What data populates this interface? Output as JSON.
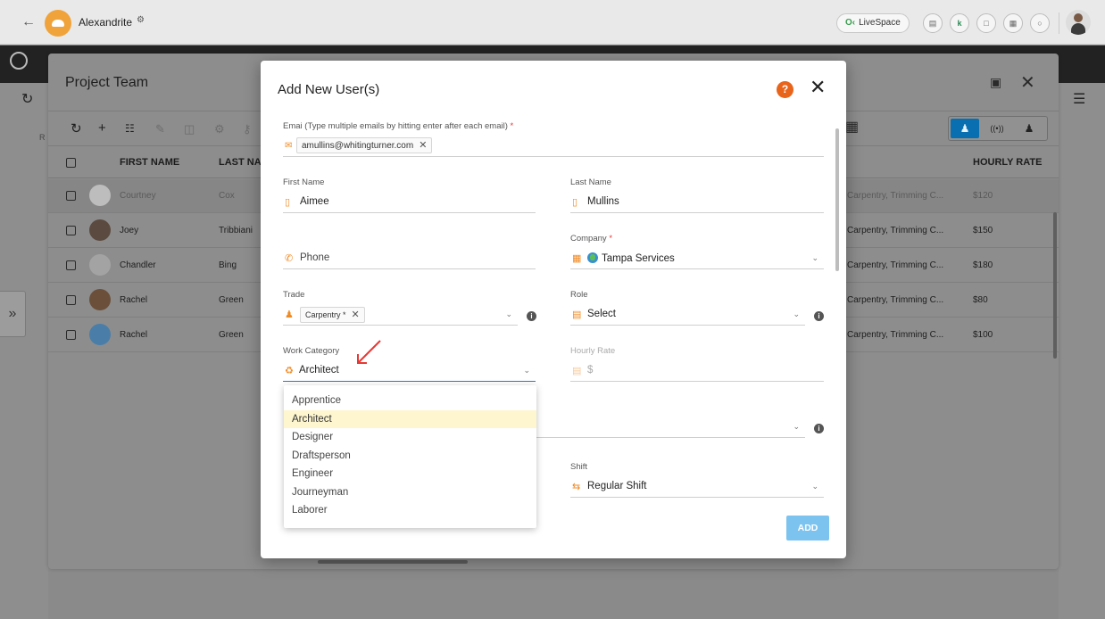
{
  "topbar": {
    "back_icon": "arrow-left-icon",
    "project_name": "Alexandrite",
    "livespace_label": "LiveSpace",
    "livespace_icon": "livespace-icon",
    "icons": [
      "document-icon",
      "k-icon",
      "chat-icon",
      "grid-icon",
      "message-icon"
    ]
  },
  "panel": {
    "title": "Project Team",
    "rail_letter": "R",
    "columns": {
      "first_name": "FIRST NAME",
      "last_name": "LAST NA",
      "hourly_rate": "HOURLY RATE"
    },
    "rows": [
      {
        "first": "Courtney",
        "last": "Cox",
        "trade": "Carpentry, Trimming C...",
        "rate": "$120",
        "avatar_color": "#bdbdbd"
      },
      {
        "first": "Joey",
        "last": "Tribbiani",
        "trade": "Carpentry, Trimming C...",
        "rate": "$150",
        "avatar_color": "#5b4a3f"
      },
      {
        "first": "Chandler",
        "last": "Bing",
        "trade": "Carpentry, Trimming C...",
        "rate": "$180",
        "avatar_color": "#a3a3a3"
      },
      {
        "first": "Rachel",
        "last": "Green",
        "trade": "Carpentry, Trimming C...",
        "rate": "$80",
        "avatar_color": "#6b4f3a"
      },
      {
        "first": "Rachel",
        "last": "Green",
        "trade": "Carpentry, Trimming C...",
        "rate": "$100",
        "avatar_color": "#4a7ea8"
      }
    ]
  },
  "modal": {
    "title": "Add New User(s)",
    "email": {
      "label": "Emai (Type multiple emails by hitting enter after each email)",
      "required_mark": "*",
      "chips": [
        "amullins@whitingturner.com"
      ]
    },
    "first_name": {
      "label": "First Name",
      "value": "Aimee"
    },
    "last_name": {
      "label": "Last Name",
      "value": "Mullins"
    },
    "phone": {
      "placeholder": "Phone"
    },
    "company": {
      "label": "Company",
      "required_mark": "*",
      "value": "Tampa Services"
    },
    "trade": {
      "label": "Trade",
      "chip": "Carpentry *"
    },
    "role": {
      "label": "Role",
      "value": "Select"
    },
    "work_category": {
      "label": "Work Category",
      "value": "Architect",
      "options": [
        "Apprentice",
        "Architect",
        "Designer",
        "Draftsperson",
        "Engineer",
        "Journeyman",
        "Laborer"
      ],
      "selected": "Architect"
    },
    "hourly_rate": {
      "label": "Hourly Rate",
      "value": "$"
    },
    "shift": {
      "label": "Shift",
      "value": "Regular Shift"
    },
    "add_button": "ADD"
  },
  "colors": {
    "accent": "#2f7ac0",
    "icon_orange": "#f08a24",
    "help": "#e8641b",
    "add_button": "#7cc3ef",
    "selected_option": "#fdf6cf"
  }
}
